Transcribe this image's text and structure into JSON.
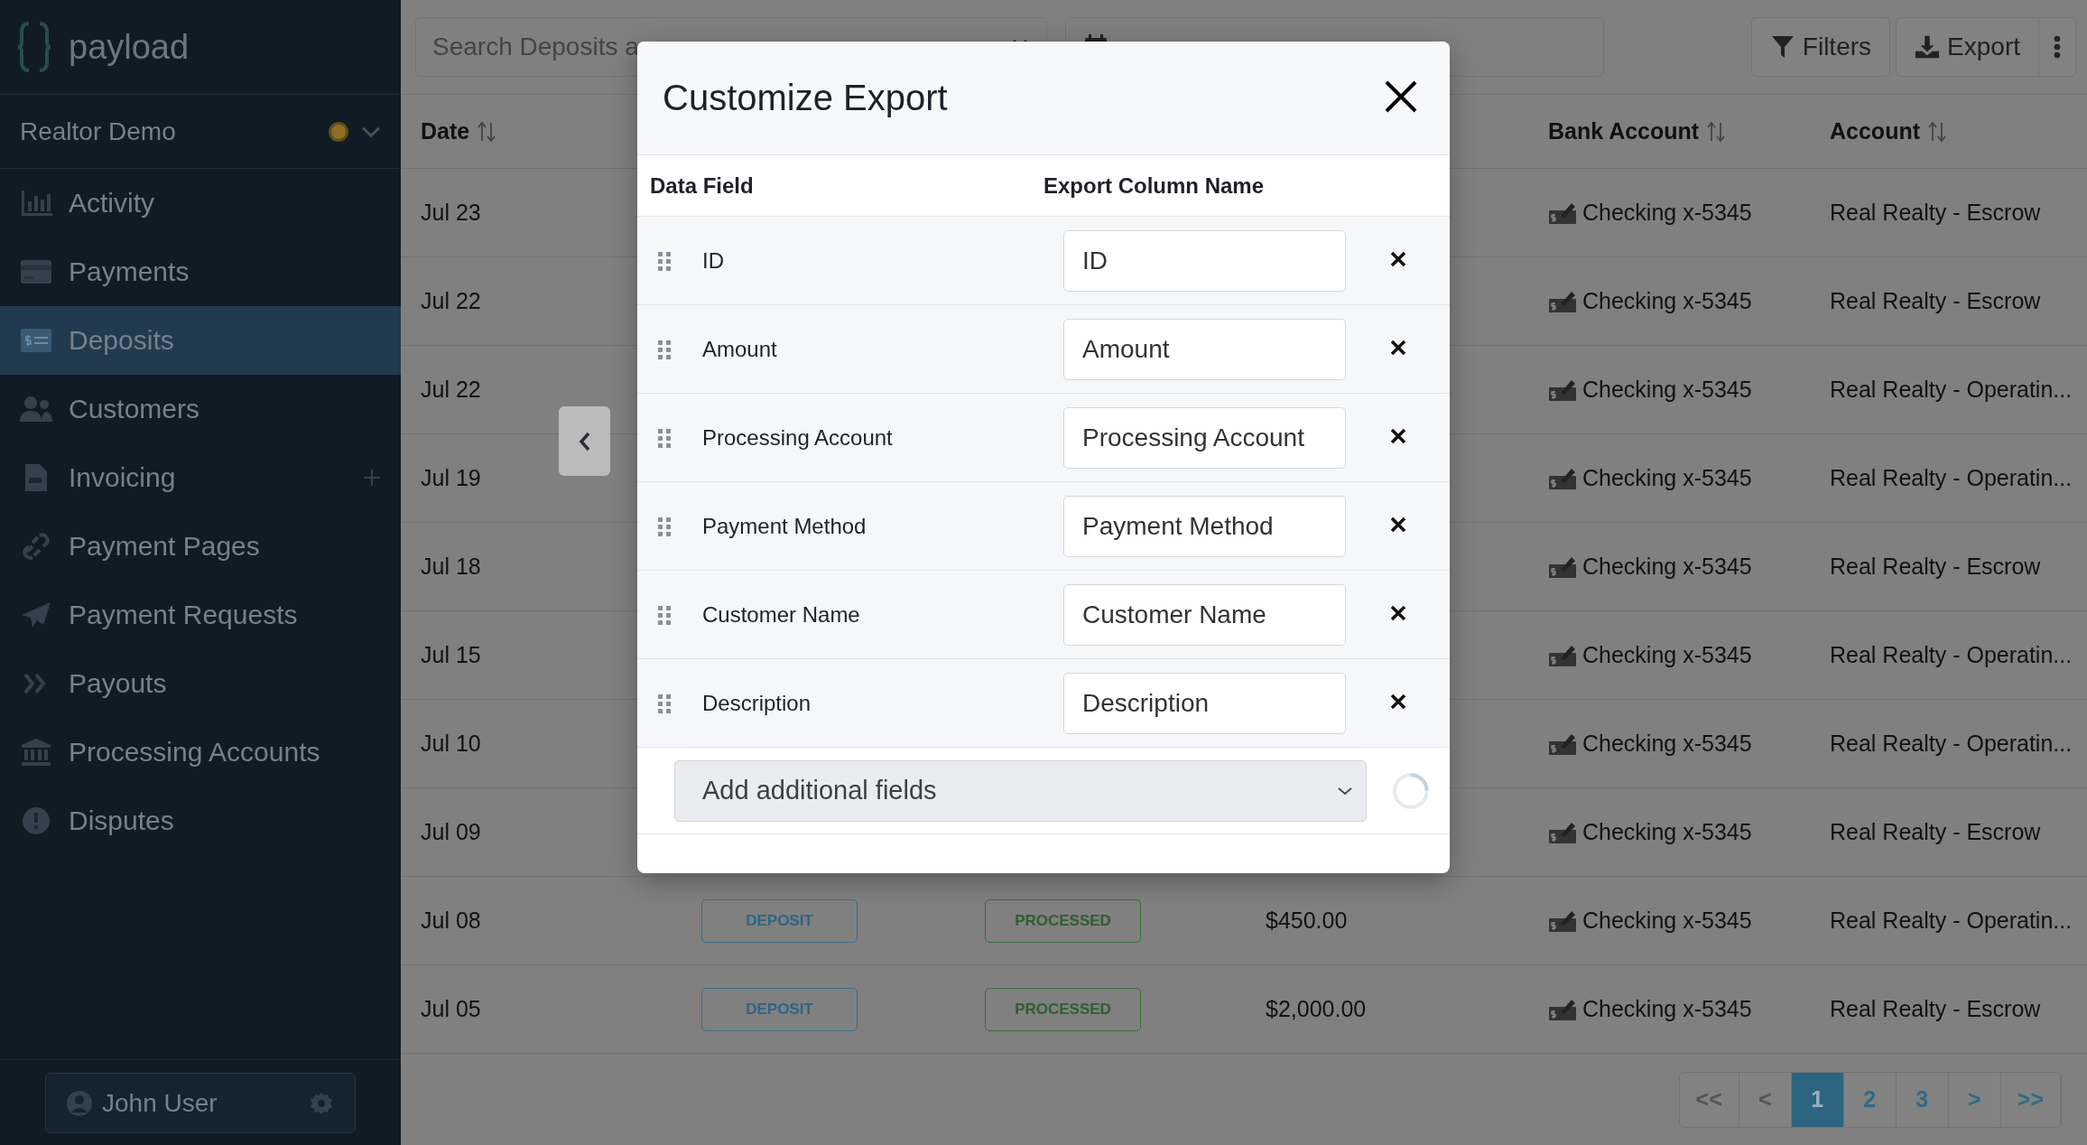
{
  "sidebar": {
    "brand": "payload",
    "workspace": {
      "name": "Realtor Demo"
    },
    "items": [
      {
        "label": "Activity",
        "selected": false,
        "has_add": false
      },
      {
        "label": "Payments",
        "selected": false,
        "has_add": false
      },
      {
        "label": "Deposits",
        "selected": true,
        "has_add": false
      },
      {
        "label": "Customers",
        "selected": false,
        "has_add": false
      },
      {
        "label": "Invoicing",
        "selected": false,
        "has_add": true
      },
      {
        "label": "Payment Pages",
        "selected": false,
        "has_add": false
      },
      {
        "label": "Payment Requests",
        "selected": false,
        "has_add": false
      },
      {
        "label": "Payouts",
        "selected": false,
        "has_add": false
      },
      {
        "label": "Processing Accounts",
        "selected": false,
        "has_add": false
      },
      {
        "label": "Disputes",
        "selected": false,
        "has_add": false
      }
    ],
    "user": {
      "name": "John User"
    }
  },
  "toolbar": {
    "search": {
      "placeholder": "Search Deposits a"
    },
    "buttons": [
      {
        "label": "Filters"
      },
      {
        "label": "Export"
      }
    ]
  },
  "table": {
    "columns": [
      {
        "label": "Date"
      },
      {
        "label": "Bank Account"
      },
      {
        "label": "Account"
      }
    ],
    "rows": [
      {
        "date": "Jul 23",
        "bank": "Checking x-5345",
        "account": "Real Realty - Escrow"
      },
      {
        "date": "Jul 22",
        "bank": "Checking x-5345",
        "account": "Real Realty - Escrow"
      },
      {
        "date": "Jul 22",
        "bank": "Checking x-5345",
        "account": "Real Realty - Operatin..."
      },
      {
        "date": "Jul 19",
        "bank": "Checking x-5345",
        "account": "Real Realty - Operatin..."
      },
      {
        "date": "Jul 18",
        "bank": "Checking x-5345",
        "account": "Real Realty - Escrow"
      },
      {
        "date": "Jul 15",
        "bank": "Checking x-5345",
        "account": "Real Realty - Operatin..."
      },
      {
        "date": "Jul 10",
        "bank": "Checking x-5345",
        "account": "Real Realty - Operatin..."
      },
      {
        "date": "Jul 09",
        "bank": "Checking x-5345",
        "account": "Real Realty - Escrow"
      },
      {
        "date": "Jul 08",
        "type": "DEPOSIT",
        "status": "PROCESSED",
        "amount": "$450.00",
        "bank": "Checking x-5345",
        "account": "Real Realty - Operatin..."
      },
      {
        "date": "Jul 05",
        "type": "DEPOSIT",
        "status": "PROCESSED",
        "amount": "$2,000.00",
        "bank": "Checking x-5345",
        "account": "Real Realty - Escrow"
      }
    ]
  },
  "pagination": [
    {
      "label": "<<",
      "selected": false
    },
    {
      "label": "<",
      "selected": false
    },
    {
      "label": "1",
      "selected": true
    },
    {
      "label": "2",
      "selected": false
    },
    {
      "label": "3",
      "selected": false
    },
    {
      "label": ">",
      "selected": false
    },
    {
      "label": ">>",
      "selected": false
    }
  ],
  "modal": {
    "title": "Customize Export",
    "columns": [
      "Data Field",
      "Export Column Name"
    ],
    "fields": [
      {
        "name": "ID",
        "value": "ID"
      },
      {
        "name": "Amount",
        "value": "Amount"
      },
      {
        "name": "Processing Account",
        "value": "Processing Account"
      },
      {
        "name": "Payment Method",
        "value": "Payment Method"
      },
      {
        "name": "Customer Name",
        "value": "Customer Name"
      },
      {
        "name": "Description",
        "value": "Description"
      }
    ],
    "add_select": {
      "placeholder": "Add additional fields"
    },
    "loading": true
  }
}
